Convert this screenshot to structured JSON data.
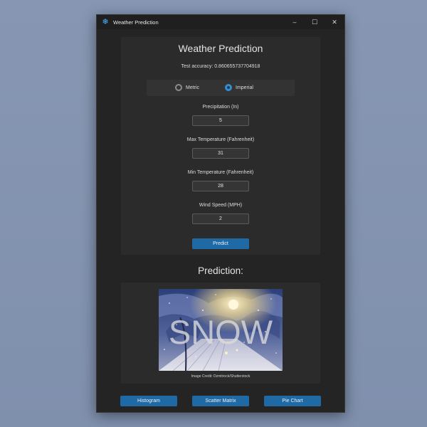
{
  "window": {
    "title": "Weather Prediction",
    "icon": "snowflake-icon",
    "controls": {
      "minimize": "–",
      "maximize": "☐",
      "close": "✕"
    }
  },
  "form": {
    "title": "Weather Prediction",
    "accuracy": "Test accuracy: 0.860655737704918",
    "units": {
      "options": [
        "Metric",
        "Imperial"
      ],
      "selected": "Imperial"
    },
    "fields": [
      {
        "label": "Precipitation (In)",
        "value": "5"
      },
      {
        "label": "Max Temperature (Fahrenheit)",
        "value": "31"
      },
      {
        "label": "Min Temperature (Fahrenheit)",
        "value": "28"
      },
      {
        "label": "Wind Speed (MPH)",
        "value": "2"
      }
    ],
    "predict_label": "Predict"
  },
  "prediction": {
    "heading": "Prediction:",
    "result": "SNOW",
    "credit": "Image Credit: Dzmitrock/Shutterstock"
  },
  "buttons": {
    "histogram": "Histogram",
    "scatter": "Scatter Matrix",
    "pie": "Pie Chart"
  },
  "colors": {
    "accent": "#1f6aa5",
    "radio_selected": "#2f8ed6",
    "window_bg": "#242424",
    "panel_bg": "#2b2b2b"
  }
}
